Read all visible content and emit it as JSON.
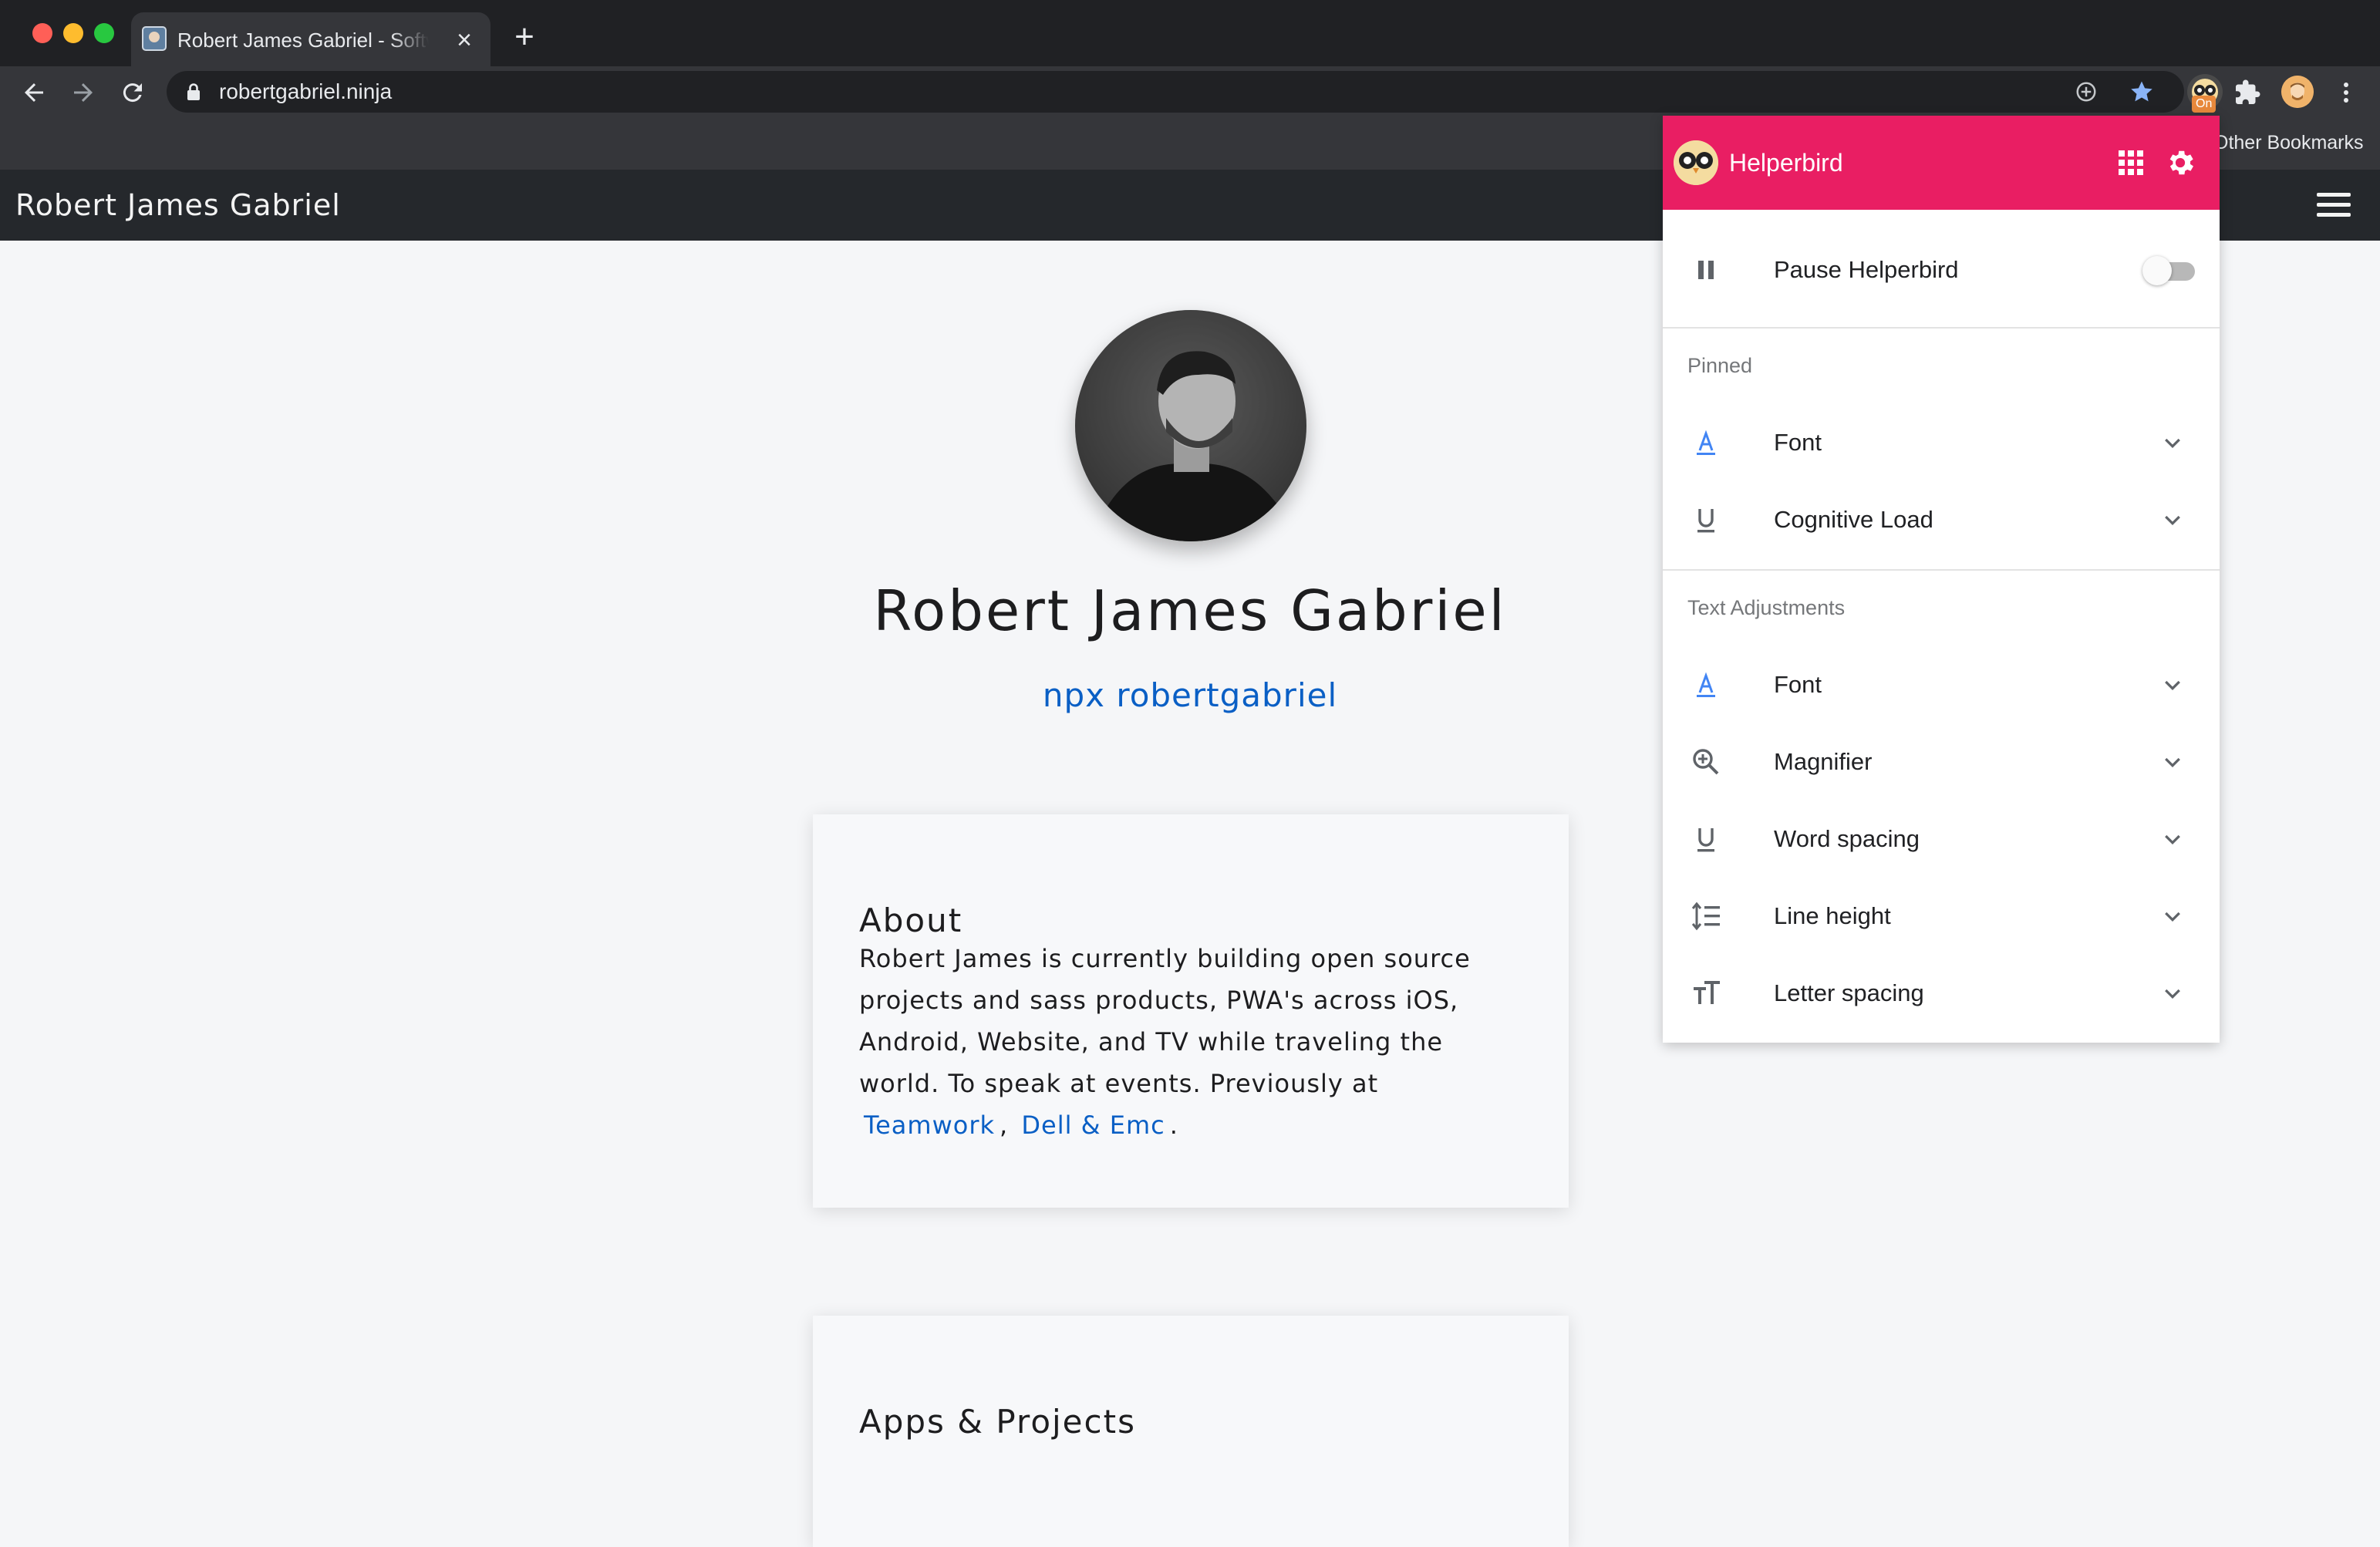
{
  "browser": {
    "tab": {
      "title": "Robert James Gabriel - Software Engineer"
    },
    "address": {
      "url": "robertgabriel.ninja"
    },
    "extension_badge": "On",
    "bookmarks": {
      "other_label": "Other Bookmarks"
    }
  },
  "site": {
    "nav_title": "Robert James Gabriel",
    "hero": {
      "name": "Robert James Gabriel",
      "npx_command": "npx robertgabriel"
    },
    "about": {
      "heading": "About",
      "text": "Robert James is currently building open source projects and sass products, PWA's across iOS, Android, Website, and TV while traveling the world. To speak at events. Previously at",
      "link_teamwork": "Teamwork",
      "separator": ",",
      "link_dell": "Dell & Emc",
      "end": "."
    },
    "apps": {
      "heading": "Apps & Projects"
    }
  },
  "helperbird": {
    "title": "Helperbird",
    "pause_label": "Pause Helperbird",
    "pause_enabled": false,
    "pinned_title": "Pinned",
    "pinned_items": [
      {
        "label": "Font",
        "icon": "font-icon"
      },
      {
        "label": "Cognitive Load",
        "icon": "underline-icon"
      }
    ],
    "text_adjustments_title": "Text Adjustments",
    "text_items": [
      {
        "label": "Font",
        "icon": "font-icon"
      },
      {
        "label": "Magnifier",
        "icon": "magnifier-icon"
      },
      {
        "label": "Word spacing",
        "icon": "underline-icon"
      },
      {
        "label": "Line height",
        "icon": "line-height-icon"
      },
      {
        "label": "Letter spacing",
        "icon": "letter-spacing-icon"
      }
    ],
    "colors": {
      "header": "#e91e63",
      "font_icon": "#4285f4"
    }
  }
}
